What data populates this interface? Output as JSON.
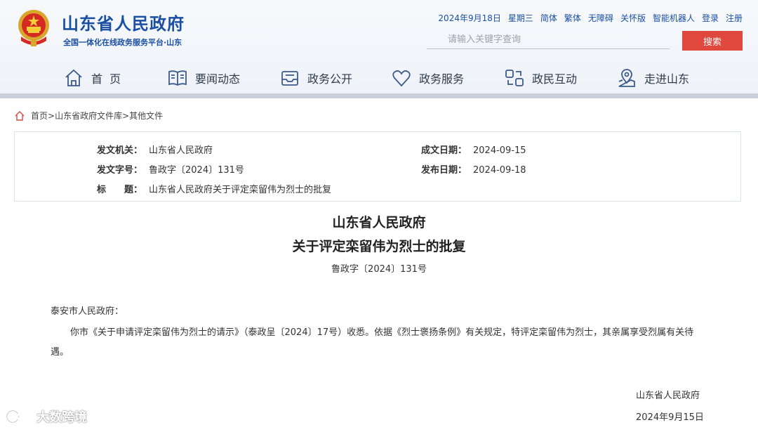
{
  "header": {
    "site_title": "山东省人民政府",
    "site_subtitle": "全国一体化在线政务服务平台·山东",
    "date": "2024年9月18日",
    "weekday": "星期三",
    "links": {
      "simplified": "简体",
      "traditional": "繁体",
      "accessibility": "无障碍",
      "elderly": "关怀版",
      "robot": "智能机器人",
      "login": "登录",
      "register": "注册"
    },
    "search_placeholder": "请输入关键字查询",
    "search_button": "搜索",
    "accent_color": "#1a4fa3",
    "search_button_color": "#e0483e"
  },
  "nav": {
    "items": [
      {
        "label": "首  页",
        "icon": "home-icon"
      },
      {
        "label": "要闻动态",
        "icon": "book-icon"
      },
      {
        "label": "政务公开",
        "icon": "inbox-icon"
      },
      {
        "label": "政务服务",
        "icon": "heart-icon"
      },
      {
        "label": "政民互动",
        "icon": "interaction-icon"
      },
      {
        "label": "走进山东",
        "icon": "map-pin-icon"
      }
    ]
  },
  "breadcrumb": {
    "home": "首页",
    "library": "山东省政府文件库",
    "current": "其他文件",
    "sep": ">"
  },
  "meta": {
    "issuer_label": "发文机关：",
    "issuer": "山东省人民政府",
    "doc_no_label": "发文字号：",
    "doc_no": "鲁政字〔2024〕131号",
    "title_label": "标　　题：",
    "title": "山东省人民政府关于评定栾留伟为烈士的批复",
    "written_label": "成文日期：",
    "written": "2024-09-15",
    "published_label": "发布日期：",
    "published": "2024-09-18"
  },
  "document": {
    "title_line1": "山东省人民政府",
    "title_line2": "关于评定栾留伟为烈士的批复",
    "number": "鲁政字〔2024〕131号",
    "addressee": "泰安市人民政府：",
    "body": "你市《关于申请评定栾留伟为烈士的请示》（泰政呈〔2024〕17号）收悉。依据《烈士褒扬条例》有关规定，特评定栾留伟为烈士，其亲属享受烈属有关待遇。",
    "sign_org": "山东省人民政府",
    "sign_date": "2024年9月15日"
  },
  "watermark": {
    "text": "大数跨境"
  }
}
